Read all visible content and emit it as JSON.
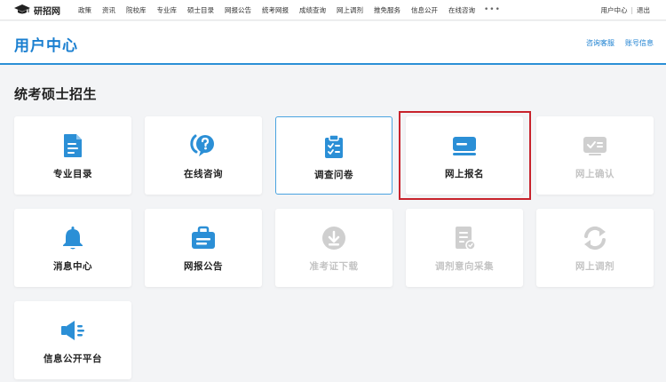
{
  "topnav": {
    "logo": "研招网",
    "items": [
      "政策",
      "资讯",
      "院校库",
      "专业库",
      "硕士目录",
      "网报公告",
      "统考网报",
      "成绩查询",
      "网上调剂",
      "推免服务",
      "信息公开",
      "在线咨询"
    ],
    "more": "•••",
    "user_center": "用户中心",
    "separator": "|",
    "logout": "退出"
  },
  "header": {
    "title": "用户中心",
    "links": [
      "咨询客服",
      "账号信息"
    ]
  },
  "section": {
    "title": "统考硕士招生"
  },
  "cards": [
    {
      "label": "专业目录",
      "icon": "document-list-icon",
      "enabled": true
    },
    {
      "label": "在线咨询",
      "icon": "chat-question-icon",
      "enabled": true
    },
    {
      "label": "调查问卷",
      "icon": "clipboard-check-icon",
      "enabled": true
    },
    {
      "label": "网上报名",
      "icon": "card-register-icon",
      "enabled": true
    },
    {
      "label": "网上确认",
      "icon": "id-confirm-icon",
      "enabled": false
    },
    {
      "label": "消息中心",
      "icon": "bell-icon",
      "enabled": true
    },
    {
      "label": "网报公告",
      "icon": "announcement-bag-icon",
      "enabled": true
    },
    {
      "label": "准考证下载",
      "icon": "download-icon",
      "enabled": false
    },
    {
      "label": "调剂意向采集",
      "icon": "form-edit-icon",
      "enabled": false
    },
    {
      "label": "网上调剂",
      "icon": "refresh-icon",
      "enabled": false
    },
    {
      "label": "信息公开平台",
      "icon": "speaker-icon",
      "enabled": true
    }
  ],
  "colors": {
    "accent": "#1a7fd0",
    "icon_active": "#2b8fd6",
    "icon_disabled": "#cfcfcf",
    "highlight": "#c8232c"
  }
}
